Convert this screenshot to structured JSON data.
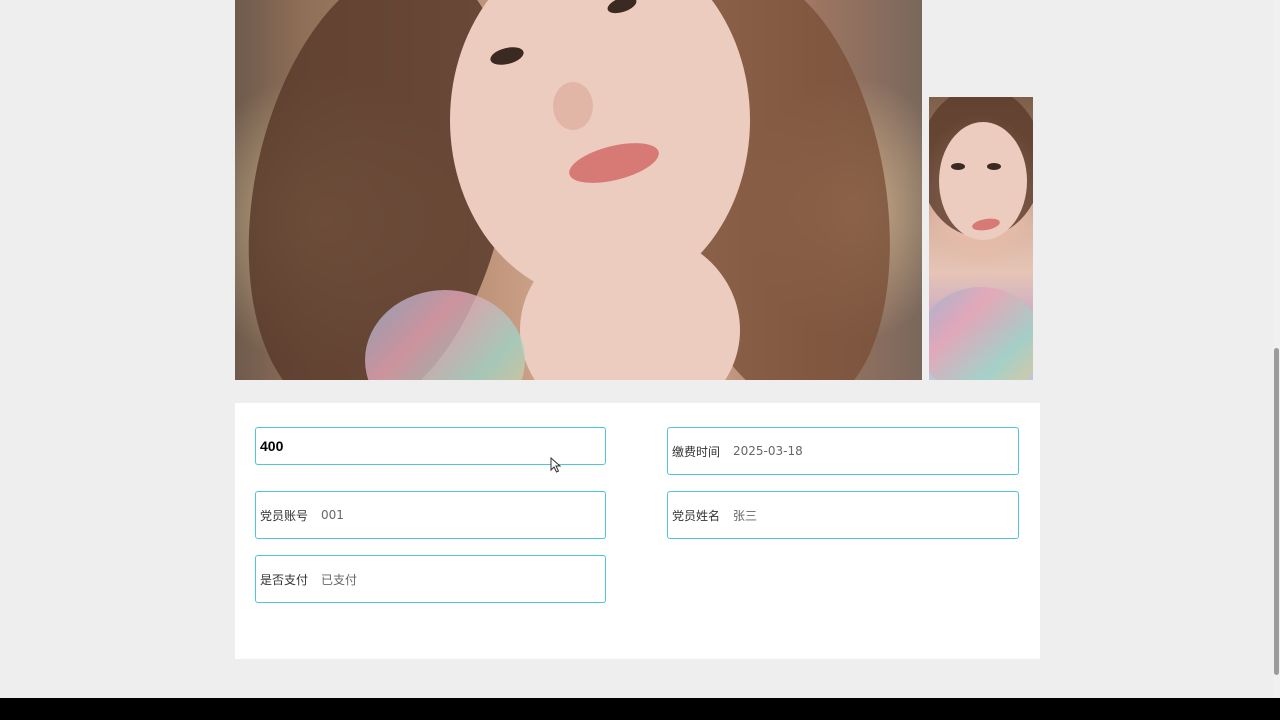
{
  "gallery": {
    "main_alt": "",
    "thumb_alt": ""
  },
  "form": {
    "amount": {
      "value": "400"
    },
    "payment_time": {
      "label": "缴费时间",
      "value": "2025-03-18"
    },
    "member_account": {
      "label": "党员账号",
      "value": "001"
    },
    "member_name": {
      "label": "党员姓名",
      "value": "张三"
    },
    "is_paid": {
      "label": "是否支付",
      "value": "已支付"
    }
  },
  "colors": {
    "field_border": "#4cc6d8",
    "panel_bg": "#ffffff",
    "page_bg": "#eeeeee"
  }
}
